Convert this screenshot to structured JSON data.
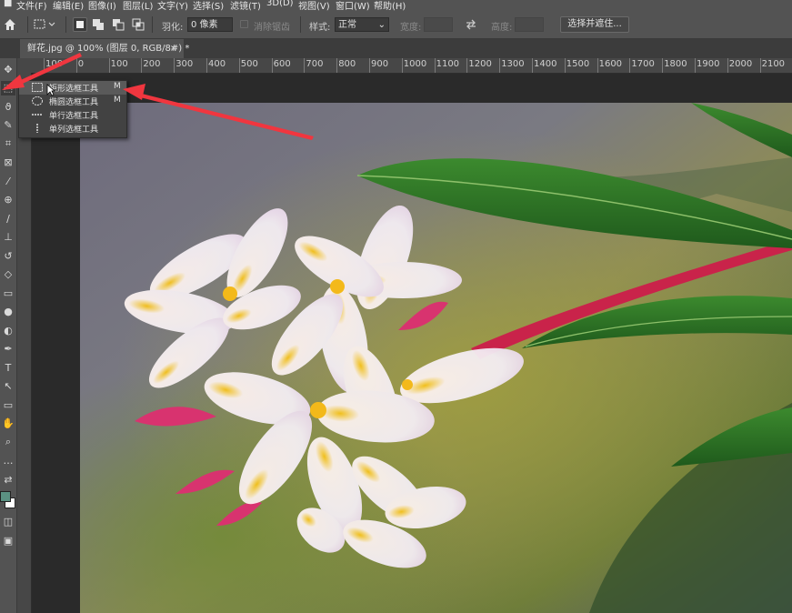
{
  "menu": {
    "items": [
      "文件(F)",
      "编辑(E)",
      "图像(I)",
      "图层(L)",
      "文字(Y)",
      "选择(S)",
      "滤镜(T)",
      "3D(D)",
      "视图(V)",
      "窗口(W)",
      "帮助(H)"
    ]
  },
  "options": {
    "feather_label": "羽化:",
    "feather_value": "0 像素",
    "antialias_label": "消除锯齿",
    "style_label": "样式:",
    "style_value": "正常",
    "width_label": "宽度:",
    "height_label": "高度:",
    "select_mask_button": "选择并遮住..."
  },
  "document": {
    "tab_title": "鲜花.jpg @ 100% (图层 0, RGB/8#) *",
    "close": "×"
  },
  "ruler": {
    "ticks": [
      "100",
      "0",
      "100",
      "200",
      "300",
      "400",
      "500",
      "600",
      "700",
      "800",
      "900",
      "1000",
      "1100",
      "1200",
      "1300",
      "1400",
      "1500",
      "1600",
      "1700",
      "1800",
      "1900",
      "2000",
      "2100"
    ]
  },
  "flyout": {
    "items": [
      {
        "label": "矩形选框工具",
        "shortcut": "M",
        "icon": "rectangular-marquee-icon"
      },
      {
        "label": "椭圆选框工具",
        "shortcut": "M",
        "icon": "elliptical-marquee-icon"
      },
      {
        "label": "单行选框工具",
        "shortcut": "",
        "icon": "single-row-marquee-icon"
      },
      {
        "label": "单列选框工具",
        "shortcut": "",
        "icon": "single-column-marquee-icon"
      }
    ]
  },
  "tools": [
    "move-tool-icon",
    "marquee-tool-icon",
    "lasso-tool-icon",
    "quick-select-icon",
    "crop-tool-icon",
    "frame-tool-icon",
    "eyedropper-icon",
    "healing-brush-icon",
    "brush-tool-icon",
    "clone-stamp-icon",
    "history-brush-icon",
    "eraser-icon",
    "gradient-tool-icon",
    "blur-tool-icon",
    "dodge-tool-icon",
    "pen-tool-icon",
    "type-tool-icon",
    "path-select-icon",
    "rectangle-tool-icon",
    "hand-tool-icon",
    "zoom-tool-icon",
    "more-tools-icon",
    "swap-colors-icon",
    "color-swatches-icon",
    "quick-mask-icon",
    "screen-mode-icon"
  ],
  "colors": {
    "annotation_arrow": "#f0363f",
    "foreground": "#5b9182",
    "background": "#ffffff"
  }
}
